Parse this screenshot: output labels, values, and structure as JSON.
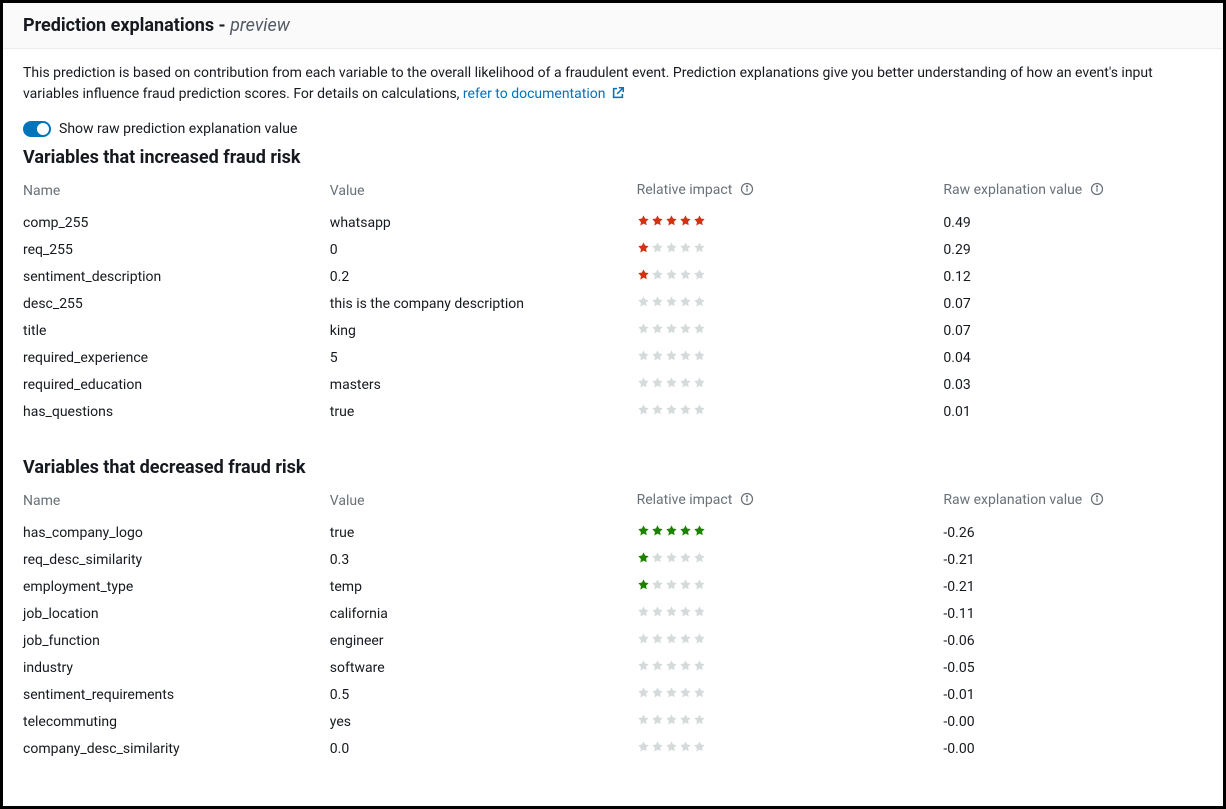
{
  "panel": {
    "title_prefix": "Prediction explanations - ",
    "title_suffix": "preview",
    "intro_text": "This prediction is based on contribution from each variable to the overall likelihood of a fraudulent event. Prediction explanations give you better understanding of how an event's input variables influence fraud prediction scores. For details on calculations, ",
    "doc_link_text": "refer to documentation",
    "toggle_label": "Show raw prediction explanation value",
    "toggle_on": true,
    "columns": {
      "name": "Name",
      "value": "Value",
      "impact": "Relative impact",
      "raw": "Raw explanation value"
    },
    "colors": {
      "red": "#d13212",
      "green": "#1d8102",
      "grey": "#d5dbdb"
    },
    "increased": {
      "heading": "Variables that increased fraud risk",
      "rows": [
        {
          "name": "comp_255",
          "value": "whatsapp",
          "stars": 5,
          "raw": "0.49"
        },
        {
          "name": "req_255",
          "value": "0",
          "stars": 1,
          "raw": "0.29"
        },
        {
          "name": "sentiment_description",
          "value": "0.2",
          "stars": 1,
          "raw": "0.12"
        },
        {
          "name": "desc_255",
          "value": "this is the company description",
          "stars": 0,
          "raw": "0.07"
        },
        {
          "name": "title",
          "value": "king",
          "stars": 0,
          "raw": "0.07"
        },
        {
          "name": "required_experience",
          "value": "5",
          "stars": 0,
          "raw": "0.04"
        },
        {
          "name": "required_education",
          "value": "masters",
          "stars": 0,
          "raw": "0.03"
        },
        {
          "name": "has_questions",
          "value": "true",
          "stars": 0,
          "raw": "0.01"
        }
      ]
    },
    "decreased": {
      "heading": "Variables that decreased fraud risk",
      "rows": [
        {
          "name": "has_company_logo",
          "value": "true",
          "stars": 5,
          "raw": "-0.26"
        },
        {
          "name": "req_desc_similarity",
          "value": "0.3",
          "stars": 1,
          "raw": "-0.21"
        },
        {
          "name": "employment_type",
          "value": "temp",
          "stars": 1,
          "raw": "-0.21"
        },
        {
          "name": "job_location",
          "value": "california",
          "stars": 0,
          "raw": "-0.11"
        },
        {
          "name": "job_function",
          "value": "engineer",
          "stars": 0,
          "raw": "-0.06"
        },
        {
          "name": "industry",
          "value": "software",
          "stars": 0,
          "raw": "-0.05"
        },
        {
          "name": "sentiment_requirements",
          "value": "0.5",
          "stars": 0,
          "raw": "-0.01"
        },
        {
          "name": "telecommuting",
          "value": "yes",
          "stars": 0,
          "raw": "-0.00"
        },
        {
          "name": "company_desc_similarity",
          "value": "0.0",
          "stars": 0,
          "raw": "-0.00"
        }
      ]
    }
  }
}
